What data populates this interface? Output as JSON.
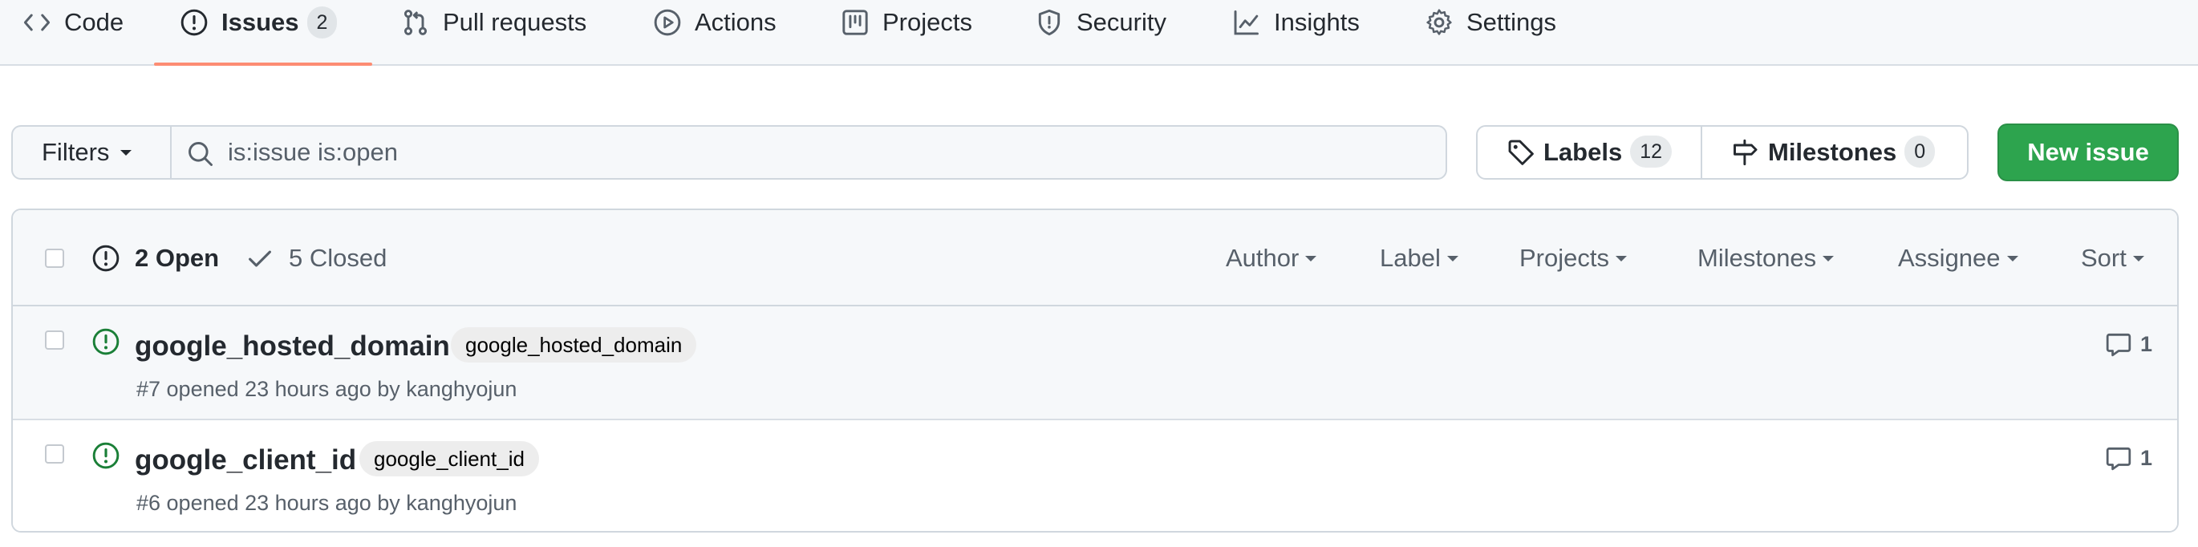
{
  "nav": {
    "items": [
      {
        "label": "Code",
        "icon": "code-icon"
      },
      {
        "label": "Issues",
        "icon": "issue-opened-icon",
        "count": "2",
        "active": true
      },
      {
        "label": "Pull requests",
        "icon": "git-pull-request-icon"
      },
      {
        "label": "Actions",
        "icon": "play-icon"
      },
      {
        "label": "Projects",
        "icon": "project-icon"
      },
      {
        "label": "Security",
        "icon": "shield-icon"
      },
      {
        "label": "Insights",
        "icon": "graph-icon"
      },
      {
        "label": "Settings",
        "icon": "gear-icon"
      }
    ],
    "active_underline_color": "#fd8c73"
  },
  "toolbar": {
    "filters_label": "Filters",
    "search_value": "is:issue is:open",
    "labels_label": "Labels",
    "labels_count": "12",
    "milestones_label": "Milestones",
    "milestones_count": "0",
    "new_issue_label": "New issue",
    "new_issue_color": "#2da44e"
  },
  "issues_header": {
    "open_label": "2 Open",
    "closed_label": "5 Closed",
    "filters": [
      "Author",
      "Label",
      "Projects",
      "Milestones",
      "Assignee",
      "Sort"
    ]
  },
  "issues": [
    {
      "title": "google_hosted_domain",
      "label": "google_hosted_domain",
      "meta_prefix": "#7 opened 23 hours ago by ",
      "author": "kanghyojun",
      "comments": "1",
      "status_color": "#1a7f37"
    },
    {
      "title": "google_client_id",
      "label": "google_client_id",
      "meta_prefix": "#6 opened 23 hours ago by ",
      "author": "kanghyojun",
      "comments": "1",
      "status_color": "#1a7f37"
    }
  ]
}
